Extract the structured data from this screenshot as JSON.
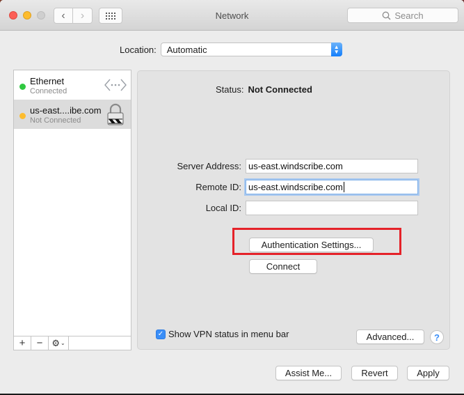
{
  "window": {
    "title": "Network",
    "search_placeholder": "Search"
  },
  "location": {
    "label": "Location:",
    "value": "Automatic"
  },
  "services": [
    {
      "name": "Ethernet",
      "status": "Connected",
      "dot_color": "#2fc840",
      "icon": "ethernet-icon"
    },
    {
      "name": "us-east....ibe.com",
      "status": "Not Connected",
      "dot_color": "#fdbc2e",
      "icon": "vpn-lock-icon",
      "selected": true
    }
  ],
  "sidebar_toolbar": {
    "add": "+",
    "remove": "−",
    "gear": "⚙"
  },
  "panel": {
    "status_label": "Status:",
    "status_value": "Not Connected",
    "fields": [
      {
        "label": "Server Address:",
        "value": "us-east.windscribe.com"
      },
      {
        "label": "Remote ID:",
        "value": "us-east.windscribe.com"
      },
      {
        "label": "Local ID:",
        "value": ""
      }
    ],
    "auth_button": "Authentication Settings...",
    "connect_button": "Connect",
    "show_vpn_status_label": "Show VPN status in menu bar",
    "show_vpn_status_checked": true,
    "advanced_button": "Advanced...",
    "help": "?"
  },
  "footer": {
    "assist_button": "Assist Me...",
    "revert_button": "Revert",
    "apply_button": "Apply"
  },
  "colors": {
    "highlight": "#e52229",
    "accent": "#3a8ef7"
  }
}
